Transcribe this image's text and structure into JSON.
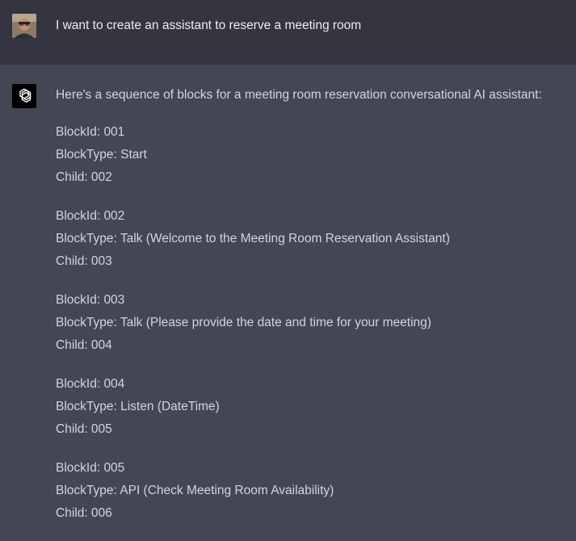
{
  "user_message": {
    "text": "I want to create an assistant to reserve a meeting room"
  },
  "assistant_message": {
    "intro": "Here's a sequence of blocks for a meeting room reservation conversational AI assistant:",
    "blocks": [
      {
        "id": "BlockId: 001",
        "type": "BlockType: Start",
        "child": "Child: 002"
      },
      {
        "id": "BlockId: 002",
        "type": "BlockType: Talk (Welcome to the Meeting Room Reservation Assistant)",
        "child": "Child: 003"
      },
      {
        "id": "BlockId: 003",
        "type": "BlockType: Talk (Please provide the date and time for your meeting)",
        "child": "Child: 004"
      },
      {
        "id": "BlockId: 004",
        "type": "BlockType: Listen (DateTime)",
        "child": "Child: 005"
      },
      {
        "id": "BlockId: 005",
        "type": "BlockType: API (Check Meeting Room Availability)",
        "child": "Child: 006"
      }
    ]
  },
  "colors": {
    "user_bg": "#343541",
    "assistant_bg": "#444654",
    "text": "#d1d5db"
  }
}
